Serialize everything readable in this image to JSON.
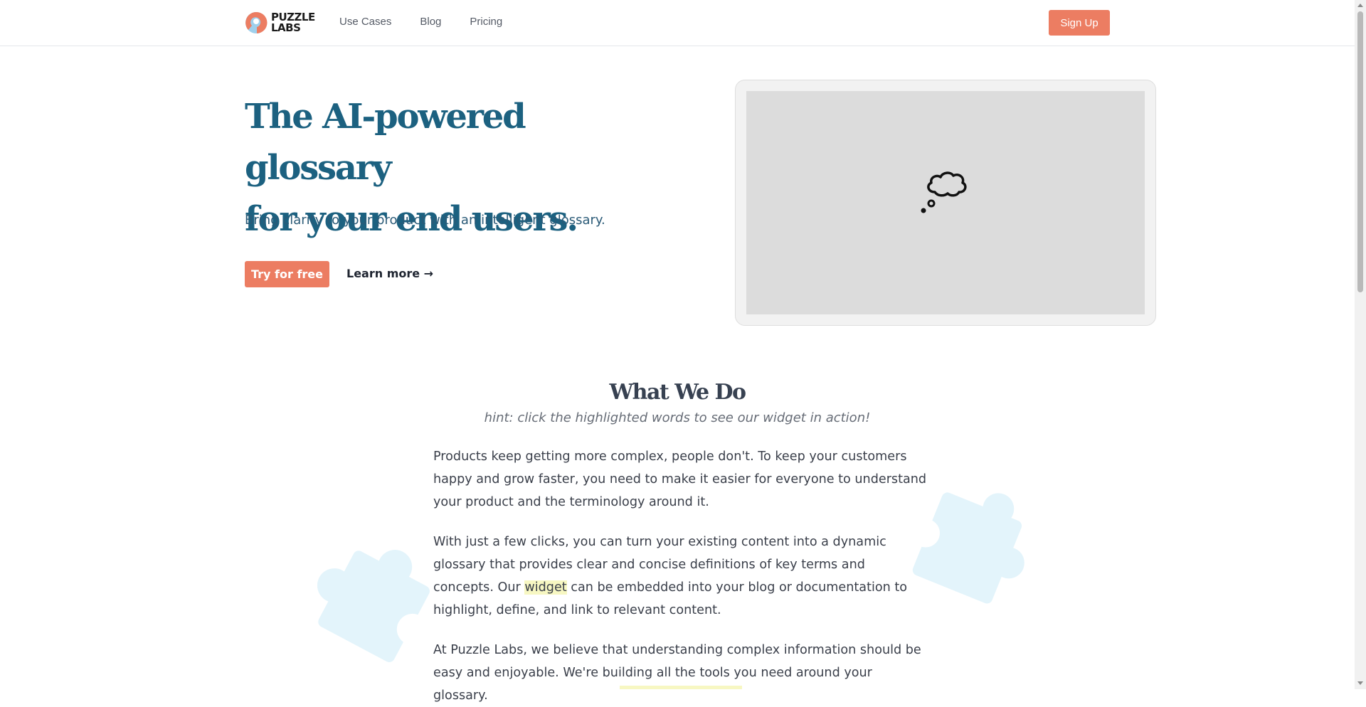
{
  "header": {
    "brand_line1": "PUZZLE",
    "brand_line2": "LABS",
    "nav": [
      "Use Cases",
      "Blog",
      "Pricing"
    ],
    "signup_label": "Sign Up"
  },
  "hero": {
    "title_line1": "The AI-powered glossary",
    "title_line2": "for your end users.",
    "subtitle": "Bring clarity to your product with an intelligent glossary.",
    "try_label": "Try for free",
    "learn_label": "Learn more →"
  },
  "what_we_do": {
    "title": "What We Do",
    "hint": "hint: click the highlighted words to see our widget in action!",
    "p1": "Products keep getting more complex, people don't. To keep your customers happy and grow faster, you need to make it easier for everyone to understand your product and the terminology around it.",
    "p2_before": "With just a few clicks, you can turn your existing content into a dynamic glossary that provides clear and concise definitions of key terms and concepts. Our ",
    "p2_highlight": "widget",
    "p2_after": " can be embedded into your blog or documentation to highlight, define, and link to relevant content.",
    "p3": "At Puzzle Labs, we believe that understanding complex information should be easy and enjoyable. We're building all the tools you need around your glossary."
  },
  "colors": {
    "accent": "#ec7d62",
    "brand_blue": "#1c6180",
    "highlight": "#f7f7c2",
    "puzzle_bg": "#e3f4fb"
  },
  "icons": {
    "logo": "puzzle-labs-logo-icon",
    "demo": "thought-bubble-icon",
    "decor": "puzzle-piece-icon"
  }
}
